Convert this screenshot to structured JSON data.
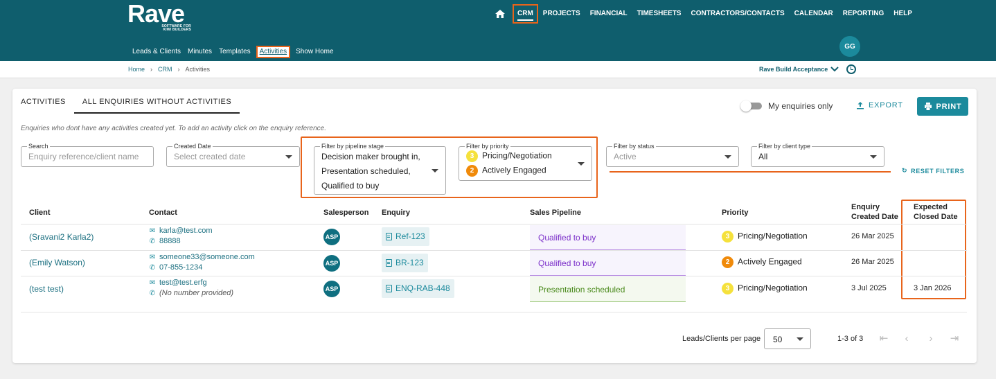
{
  "brand": {
    "name": "Rave",
    "tagline": "SOFTWARE FOR KIWI BUILDERS"
  },
  "topnav": [
    "CRM",
    "PROJECTS",
    "FINANCIAL",
    "TIMESHEETS",
    "CONTRACTORS/CONTACTS",
    "CALENDAR",
    "REPORTING",
    "HELP"
  ],
  "subnav": [
    "Leads & Clients",
    "Minutes",
    "Templates",
    "Activities",
    "Show Home"
  ],
  "user": {
    "initials": "GG"
  },
  "breadcrumb": [
    "Home",
    "CRM",
    "Activities"
  ],
  "company": "Rave Build Acceptance",
  "tabs": [
    "ACTIVITIES",
    "ALL ENQUIRIES WITHOUT ACTIVITIES"
  ],
  "toggle_label": "My enquiries only",
  "export_label": "EXPORT",
  "print_label": "PRINT",
  "helptext": "Enquiries who dont have any activities created yet. To add an activity click on the enquiry reference.",
  "filters": {
    "search": {
      "label": "Search",
      "placeholder": "Enquiry reference/client name"
    },
    "created_date": {
      "label": "Created Date",
      "placeholder": "Select created date"
    },
    "pipeline": {
      "label": "Filter by pipeline stage",
      "values": [
        "Decision maker brought in,",
        "Presentation scheduled,",
        "Qualified to buy"
      ]
    },
    "priority": {
      "label": "Filter by priority",
      "values": [
        {
          "num": "3",
          "text": "Pricing/Negotiation"
        },
        {
          "num": "2",
          "text": "Actively Engaged"
        }
      ]
    },
    "status": {
      "label": "Filter by status",
      "placeholder": "Active"
    },
    "client_type": {
      "label": "Filter by client type",
      "value": "All"
    },
    "reset_label": "RESET FILTERS"
  },
  "columns": {
    "client": "Client",
    "contact": "Contact",
    "salesperson": "Salesperson",
    "enquiry": "Enquiry",
    "pipeline": "Sales Pipeline",
    "priority": "Priority",
    "created_1": "Enquiry",
    "created_2": "Created Date",
    "closed_1": "Expected",
    "closed_2": "Closed Date"
  },
  "rows": [
    {
      "client": "(Sravani2 Karla2)",
      "email": "karla@test.com",
      "phone": "88888",
      "salesperson": "ASP",
      "enquiry": "Ref-123",
      "pipeline": "Qualified to buy",
      "priority_num": "3",
      "priority": "Pricing/Negotiation",
      "created": "26 Mar 2025",
      "closed": ""
    },
    {
      "client": "(Emily Watson)",
      "email": "someone33@someone.com",
      "phone": "07-855-1234",
      "salesperson": "ASP",
      "enquiry": "BR-123",
      "pipeline": "Qualified to buy",
      "priority_num": "2",
      "priority": "Actively Engaged",
      "created": "26 Mar 2025",
      "closed": ""
    },
    {
      "client": "(test test)",
      "email": "test@test.erfg",
      "phone": "(No number provided)",
      "salesperson": "ASP",
      "enquiry": "ENQ-RAB-448",
      "pipeline": "Presentation scheduled",
      "priority_num": "3",
      "priority": "Pricing/Negotiation",
      "created": "3 Jul 2025",
      "closed": "3 Jan 2026"
    }
  ],
  "pager": {
    "label": "Leads/Clients per page",
    "per_page": "50",
    "count": "1-3 of 3"
  },
  "colors": {
    "header": "#0f5e6d",
    "accent": "#1b8a9c",
    "highlight": "#e8641b"
  }
}
